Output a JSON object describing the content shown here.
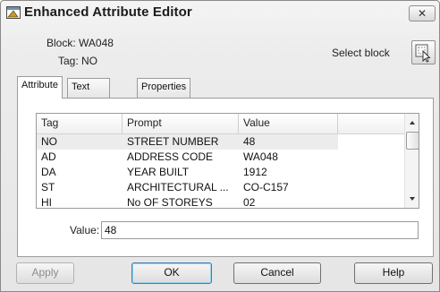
{
  "window": {
    "title": "Enhanced Attribute Editor",
    "close_icon": "✕"
  },
  "info": {
    "block": "Block: WA048",
    "tag": "Tag: NO",
    "select_block_label": "Select block"
  },
  "tabs": [
    {
      "label": "Attribute",
      "active": true
    },
    {
      "label": "Text Options",
      "active": false
    },
    {
      "label": "Properties",
      "active": false
    }
  ],
  "grid": {
    "columns": [
      "Tag",
      "Prompt",
      "Value"
    ],
    "rows": [
      {
        "tag": "NO",
        "prompt": "STREET NUMBER",
        "value": "48",
        "selected": true
      },
      {
        "tag": "AD",
        "prompt": "ADDRESS CODE",
        "value": "WA048",
        "selected": false
      },
      {
        "tag": "DA",
        "prompt": "YEAR BUILT",
        "value": "1912",
        "selected": false
      },
      {
        "tag": "ST",
        "prompt": "ARCHITECTURAL ...",
        "value": "CO-C157",
        "selected": false
      },
      {
        "tag": "HI",
        "prompt": "No OF STOREYS",
        "value": "02",
        "selected": false
      }
    ]
  },
  "value_field": {
    "label": "Value:",
    "value": "48"
  },
  "buttons": {
    "apply": "Apply",
    "ok": "OK",
    "cancel": "Cancel",
    "help": "Help"
  },
  "icons": {
    "app": "attribute-editor-icon",
    "close": "close-icon",
    "select_block": "select-block-icon",
    "scroll_up": "chevron-up-icon",
    "scroll_down": "chevron-down-icon"
  }
}
